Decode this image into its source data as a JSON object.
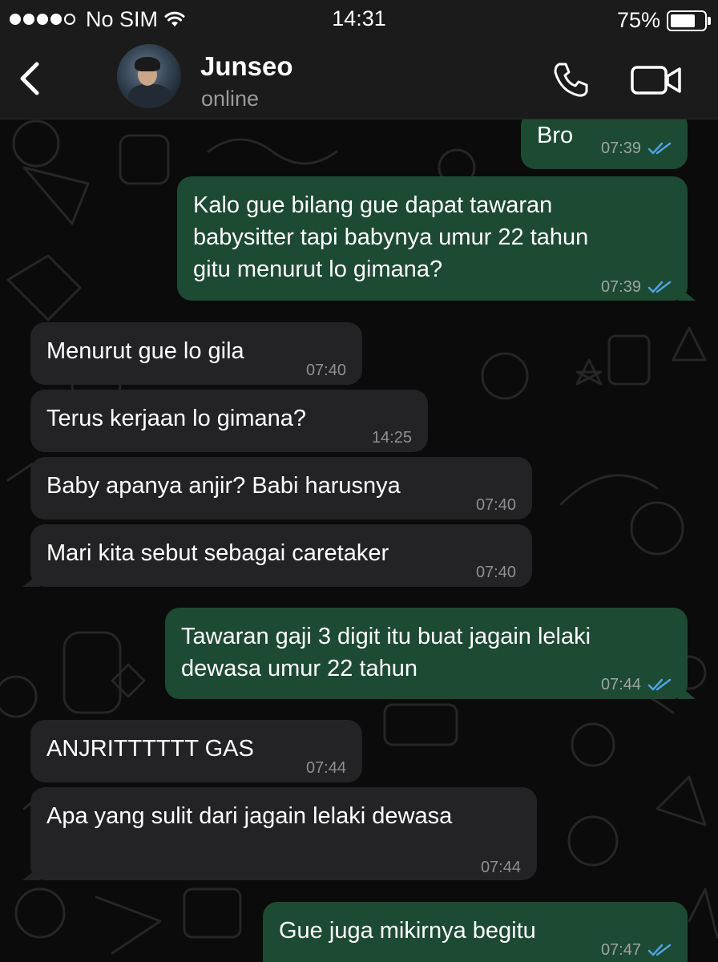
{
  "status_bar": {
    "carrier": "No SIM",
    "time": "14:31",
    "battery": "75%"
  },
  "header": {
    "contact_name": "Junseo",
    "contact_status": "online"
  },
  "messages": [
    {
      "direction": "out",
      "text": "Bro",
      "time": "07:39",
      "read": true
    },
    {
      "direction": "out",
      "lines": [
        "Kalo gue bilang gue dapat tawaran",
        "babysitter tapi babynya umur 22 tahun",
        "gitu menurut lo gimana?"
      ],
      "time": "07:39",
      "read": true
    },
    {
      "direction": "in",
      "text": "Menurut gue lo gila",
      "time": "07:40"
    },
    {
      "direction": "in",
      "text": "Terus kerjaan lo gimana?",
      "time": "14:25"
    },
    {
      "direction": "in",
      "text": "Baby apanya anjir? Babi harusnya",
      "time": "07:40"
    },
    {
      "direction": "in",
      "text": "Mari kita sebut sebagai caretaker",
      "time": "07:40"
    },
    {
      "direction": "out",
      "lines": [
        "Tawaran gaji 3 digit itu buat jagain lelaki",
        "dewasa umur 22 tahun"
      ],
      "time": "07:44",
      "read": true
    },
    {
      "direction": "in",
      "text": "ANJRITTTTTT GAS",
      "time": "07:44"
    },
    {
      "direction": "in",
      "text": "Apa yang sulit dari jagain lelaki dewasa",
      "time": "07:44"
    },
    {
      "direction": "out",
      "text": "Gue juga mikirnya begitu",
      "time": "07:47",
      "read": true
    }
  ],
  "colors": {
    "outgoing_bubble": "#1d4a33",
    "incoming_bubble": "#232325",
    "read_ticks": "#4fa3e0",
    "background": "#0b0b0b"
  }
}
